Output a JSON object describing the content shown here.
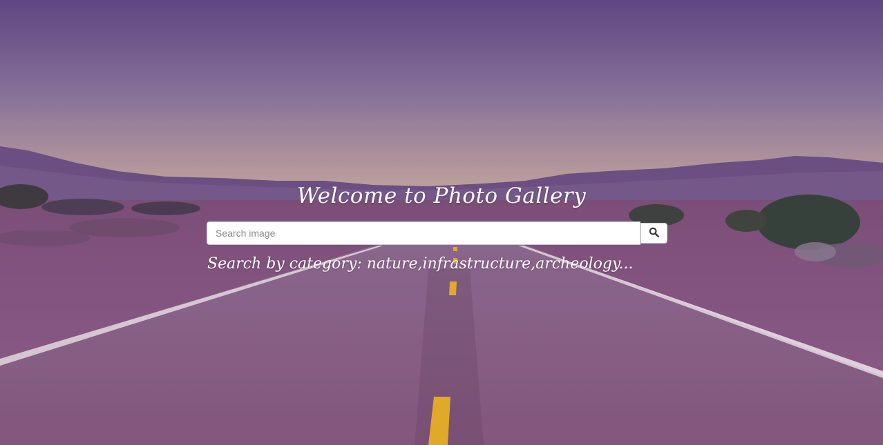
{
  "hero": {
    "title": "Welcome to Photo Gallery"
  },
  "search": {
    "placeholder": "Search image",
    "value": "",
    "button_icon": "search-icon"
  },
  "hint": {
    "text": "Search by category: nature,infrastructure,archeology..."
  },
  "colors": {
    "sky_top": "#5f4680",
    "sky_horizon": "#c6a89a",
    "road": "#8a5f8c",
    "lane_line": "#e0a92a"
  }
}
